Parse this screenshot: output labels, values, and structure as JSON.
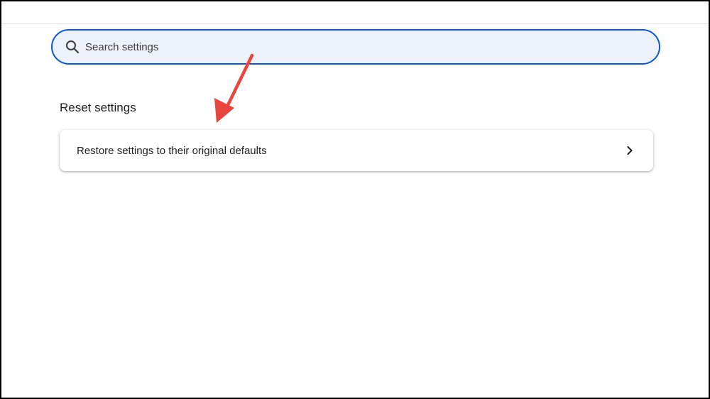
{
  "search": {
    "placeholder": "Search settings",
    "value": ""
  },
  "reset_section": {
    "title": "Reset settings",
    "items": [
      {
        "label": "Restore settings to their original defaults"
      }
    ]
  },
  "icons": {
    "search": "search-icon",
    "chevron": "chevron-right-icon",
    "annotation": "red-arrow-icon"
  },
  "colors": {
    "accent": "#0b57d0",
    "search_bg": "#edf1f9",
    "annotation": "#e8453c"
  }
}
